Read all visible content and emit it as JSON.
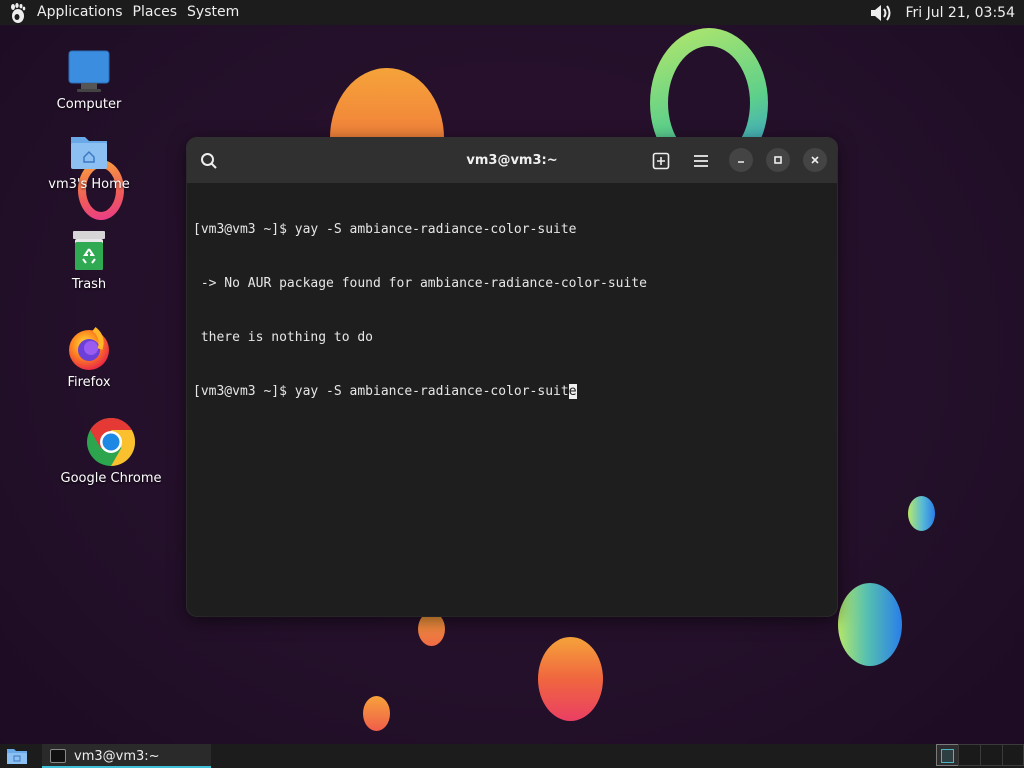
{
  "top_panel": {
    "menus": [
      "Applications",
      "Places",
      "System"
    ],
    "clock": "Fri Jul 21, 03:54",
    "volume_icon": "speaker-icon"
  },
  "desktop_icons": [
    {
      "label": "Computer",
      "icon": "computer-icon"
    },
    {
      "label": "vm3's Home",
      "icon": "home-folder-icon"
    },
    {
      "label": "Trash",
      "icon": "trash-icon"
    },
    {
      "label": "Firefox",
      "icon": "firefox-icon"
    },
    {
      "label": "Google Chrome",
      "icon": "chrome-icon"
    }
  ],
  "terminal": {
    "title": "vm3@vm3:~",
    "lines": [
      "[vm3@vm3 ~]$ yay -S ambiance-radiance-color-suite",
      " -> No AUR package found for ambiance-radiance-color-suite",
      " there is nothing to do"
    ],
    "prompt_line_before_cursor": "[vm3@vm3 ~]$ yay -S ambiance-radiance-color-suit",
    "cursor_char": "e",
    "buttons": [
      "search-icon",
      "new-tab-icon",
      "hamburger-menu-icon",
      "minimize-icon",
      "maximize-icon",
      "close-icon"
    ]
  },
  "bottom_panel": {
    "task_label": "vm3@vm3:~",
    "workspaces": 4,
    "active_workspace": 1
  },
  "colors": {
    "panel_bg": "#1c1c1c",
    "terminal_bg": "#1e1e1e",
    "header_bg": "#303030",
    "accent": "#3fbfd8"
  }
}
